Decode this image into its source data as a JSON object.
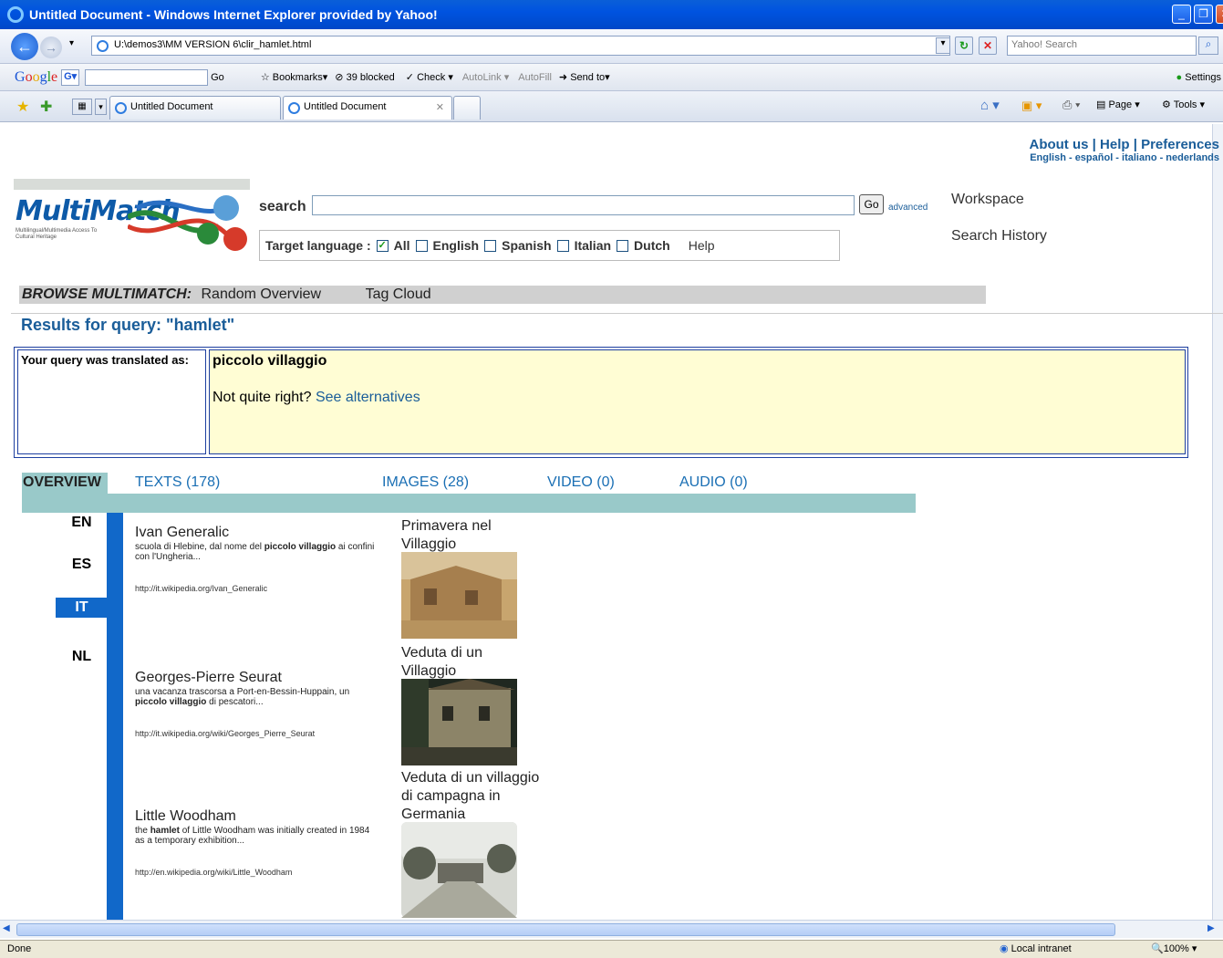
{
  "window": {
    "title": "Untitled Document - Windows Internet Explorer provided by Yahoo!"
  },
  "address": {
    "url": "U:\\demos3\\MM VERSION 6\\clir_hamlet.html",
    "search_placeholder": "Yahoo! Search"
  },
  "googlebar": {
    "items": [
      "Go",
      "Bookmarks",
      "39 blocked",
      "Check",
      "AutoLink",
      "AutoFill",
      "Send to",
      "Settings"
    ]
  },
  "tabs": [
    {
      "label": "Untitled Document"
    },
    {
      "label": "Untitled Document"
    }
  ],
  "commandbar": {
    "page": "Page",
    "tools": "Tools"
  },
  "toplinks": {
    "about": "About us",
    "help": "Help",
    "prefs": "Preferences",
    "langs": "English - español - italiano - nederlands",
    "sep": "|"
  },
  "logo": {
    "word": "MultiMatch",
    "tagline": "Multilingual/Multimedia Access To Cultural Heritage"
  },
  "search": {
    "label": "search",
    "go": "Go",
    "advanced": "advanced"
  },
  "side": {
    "workspace": "Workspace",
    "history": "Search History"
  },
  "target": {
    "label": "Target language :",
    "options": [
      "All",
      "English",
      "Spanish",
      "Italian",
      "Dutch"
    ],
    "help": "Help"
  },
  "browse": {
    "label": "BROWSE MULTIMATCH:",
    "random": "Random Overview",
    "tag": "Tag Cloud"
  },
  "results": {
    "title": "Results for query: \"hamlet\""
  },
  "translation": {
    "label": "Your query was translated as:",
    "query": "piccolo villaggio",
    "notright": "Not quite right?",
    "alternatives": "See alternatives"
  },
  "result_tabs": {
    "overview": "OVERVIEW",
    "texts": "TEXTS (178)",
    "images": "IMAGES (28)",
    "video": "VIDEO (0)",
    "audio": "AUDIO (0)"
  },
  "languages": [
    "EN",
    "ES",
    "IT",
    "NL"
  ],
  "text_results": [
    {
      "title": "Ivan Generalic",
      "snippet_pre": "scuola di Hlebine, dal nome del ",
      "snippet_bold": "piccolo villaggio",
      "snippet_post": " ai confini con l'Ungheria...",
      "url": "http://it.wikipedia.org/Ivan_Generalic"
    },
    {
      "title": "Georges-Pierre Seurat",
      "snippet_pre": "una vacanza trascorsa a Port-en-Bessin-Huppain, un ",
      "snippet_bold": "piccolo villaggio",
      "snippet_post": " di pescatori...",
      "url": "http://it.wikipedia.org/wiki/Georges_Pierre_Seurat"
    },
    {
      "title": "Little Woodham",
      "snippet_pre": "the ",
      "snippet_bold": "hamlet",
      "snippet_post": " of Little Woodham was initially created in 1984 as a temporary exhibition...",
      "url": "http://en.wikipedia.org/wiki/Little_Woodham"
    }
  ],
  "image_results": [
    {
      "title": "Primavera nel Villaggio"
    },
    {
      "title": "Veduta di un Villaggio"
    },
    {
      "title": "Veduta di un villaggio di campagna in Germania"
    }
  ],
  "status": {
    "text": "Done",
    "zone": "Local intranet",
    "zoom": "100%"
  }
}
